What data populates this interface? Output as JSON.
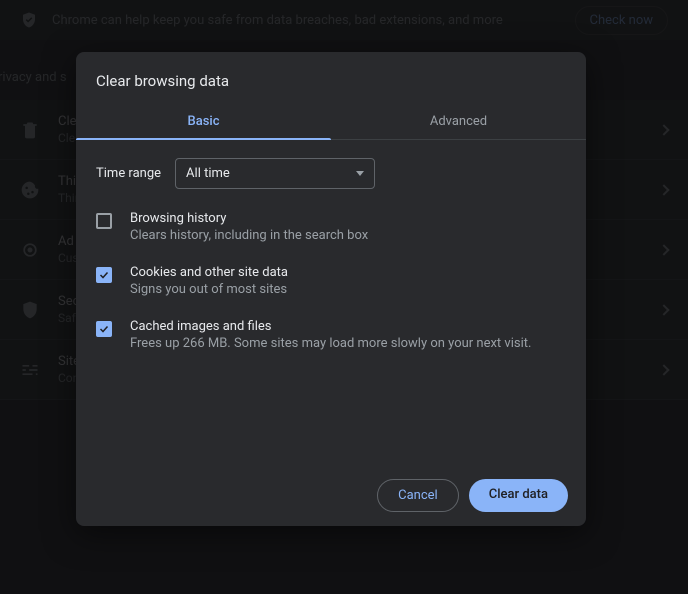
{
  "banner": {
    "text": "Chrome can help keep you safe from data breaches, bad extensions, and more",
    "button": "Check now"
  },
  "section_label": "rivacy and s",
  "rows": [
    {
      "title": "Clear",
      "sub": "Clear"
    },
    {
      "title": "Third",
      "sub": "Third"
    },
    {
      "title": "Ad p",
      "sub": "Custo"
    },
    {
      "title": "Secu",
      "sub": "Safe"
    },
    {
      "title": "Site s",
      "sub": "Cont"
    }
  ],
  "dialog": {
    "title": "Clear browsing data",
    "tabs": {
      "basic": "Basic",
      "advanced": "Advanced"
    },
    "time_label": "Time range",
    "time_value": "All time",
    "options": [
      {
        "title": "Browsing history",
        "sub": "Clears history, including in the search box",
        "checked": false
      },
      {
        "title": "Cookies and other site data",
        "sub": "Signs you out of most sites",
        "checked": true
      },
      {
        "title": "Cached images and files",
        "sub": "Frees up 266 MB. Some sites may load more slowly on your next visit.",
        "checked": true
      }
    ],
    "cancel": "Cancel",
    "confirm": "Clear data"
  }
}
